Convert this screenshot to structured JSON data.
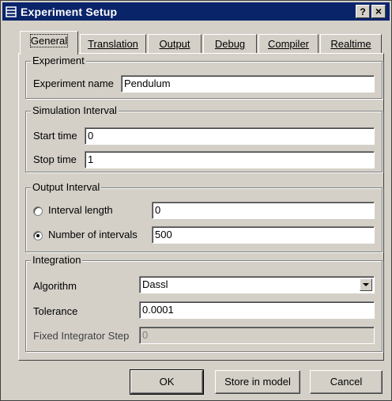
{
  "window": {
    "title": "Experiment Setup",
    "help_button": "?",
    "close_button": "×"
  },
  "tabs": [
    {
      "label": "General",
      "active": true
    },
    {
      "label": "Translation"
    },
    {
      "label": "Output"
    },
    {
      "label": "Debug"
    },
    {
      "label": "Compiler"
    },
    {
      "label": "Realtime"
    }
  ],
  "experiment": {
    "group_label": "Experiment",
    "name_label": "Experiment name",
    "name_value": "Pendulum"
  },
  "simulation_interval": {
    "group_label": "Simulation Interval",
    "start_label": "Start time",
    "start_value": "0",
    "stop_label": "Stop time",
    "stop_value": "1"
  },
  "output_interval": {
    "group_label": "Output Interval",
    "interval_length_label": "Interval length",
    "interval_length_value": "0",
    "interval_length_selected": false,
    "num_intervals_label": "Number of intervals",
    "num_intervals_value": "500",
    "num_intervals_selected": true
  },
  "integration": {
    "group_label": "Integration",
    "algorithm_label": "Algorithm",
    "algorithm_value": "Dassl",
    "tolerance_label": "Tolerance",
    "tolerance_value": "0.0001",
    "fixed_step_label": "Fixed Integrator Step",
    "fixed_step_value": "0"
  },
  "buttons": {
    "ok": "OK",
    "store": "Store in model",
    "cancel": "Cancel"
  }
}
